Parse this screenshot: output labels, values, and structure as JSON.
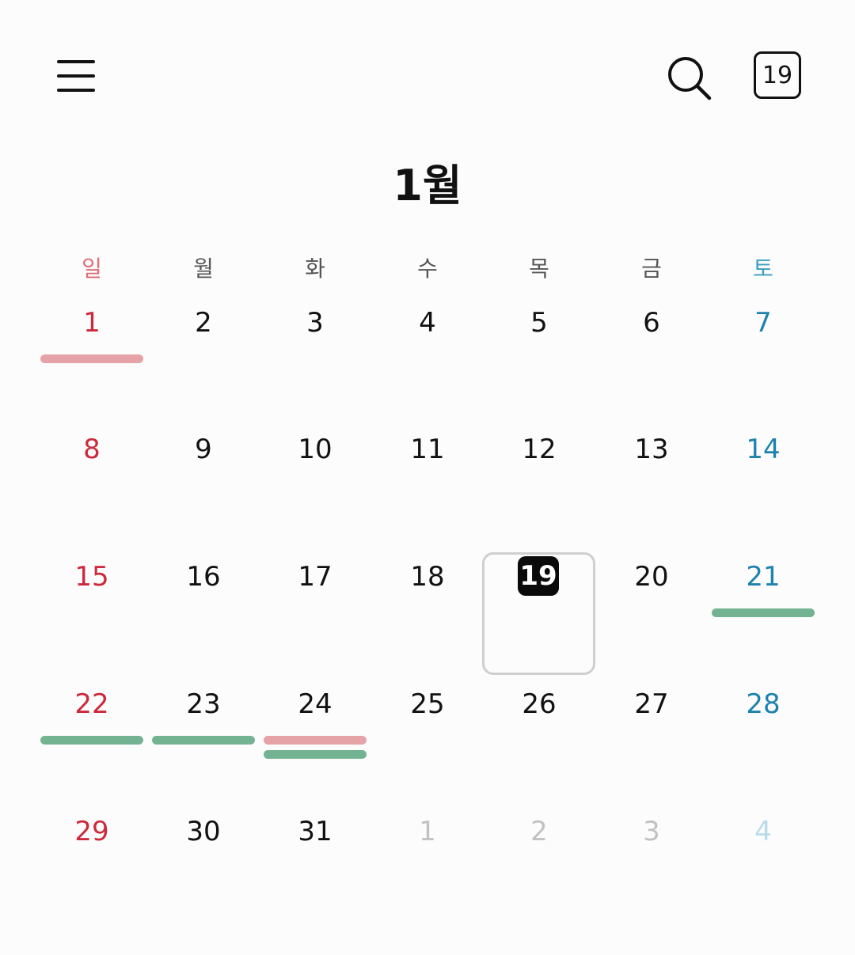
{
  "header": {
    "menu_icon": "hamburger-menu-icon",
    "search_icon": "search-icon",
    "today_button_label": "19"
  },
  "month_title": "1월",
  "weekdays": [
    "일",
    "월",
    "화",
    "수",
    "목",
    "금",
    "토"
  ],
  "colors": {
    "sunday": "#cc2a3a",
    "saturday": "#1d82ad",
    "event_red": "#e5a3a7",
    "event_green": "#74b392",
    "today_badge": "#0a0a0a"
  },
  "weeks": [
    [
      "1",
      "2",
      "3",
      "4",
      "5",
      "6",
      "7"
    ],
    [
      "8",
      "9",
      "10",
      "11",
      "12",
      "13",
      "14"
    ],
    [
      "15",
      "16",
      "17",
      "18",
      "19",
      "20",
      "21"
    ],
    [
      "22",
      "23",
      "24",
      "25",
      "26",
      "27",
      "28"
    ],
    [
      "29",
      "30",
      "31",
      "1",
      "2",
      "3",
      "4"
    ]
  ],
  "today": "19",
  "events": [
    {
      "day": "1",
      "colors": [
        "red"
      ]
    },
    {
      "day": "21",
      "colors": [
        "green"
      ]
    },
    {
      "day": "22",
      "colors": [
        "green"
      ]
    },
    {
      "day": "23",
      "colors": [
        "green"
      ]
    },
    {
      "day": "24",
      "colors": [
        "red",
        "green"
      ]
    }
  ]
}
